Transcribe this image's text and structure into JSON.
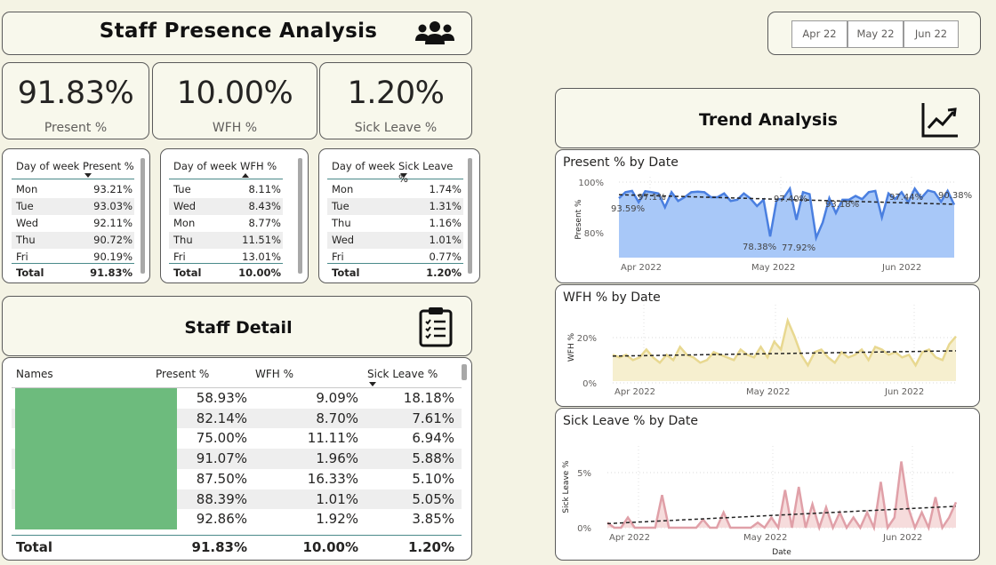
{
  "header": {
    "title": "Staff Presence Analysis",
    "icon": "people-group-icon"
  },
  "slicer": {
    "months": [
      "Apr 22",
      "May 22",
      "Jun 22"
    ]
  },
  "kpis": [
    {
      "value": "91.83%",
      "label": "Present %"
    },
    {
      "value": "10.00%",
      "label": "WFH %"
    },
    {
      "value": "1.20%",
      "label": "Sick Leave %"
    }
  ],
  "present_table": {
    "headers": [
      "Day of week",
      "Present %"
    ],
    "rows": [
      [
        "Mon",
        "93.21%"
      ],
      [
        "Tue",
        "93.03%"
      ],
      [
        "Wed",
        "92.11%"
      ],
      [
        "Thu",
        "90.72%"
      ],
      [
        "Fri",
        "90.19%"
      ]
    ],
    "total": [
      "Total",
      "91.83%"
    ]
  },
  "wfh_table": {
    "headers": [
      "Day of week",
      "WFH %"
    ],
    "rows": [
      [
        "Tue",
        "8.11%"
      ],
      [
        "Wed",
        "8.43%"
      ],
      [
        "Mon",
        "8.77%"
      ],
      [
        "Thu",
        "11.51%"
      ],
      [
        "Fri",
        "13.01%"
      ]
    ],
    "total": [
      "Total",
      "10.00%"
    ]
  },
  "sick_table": {
    "headers": [
      "Day of week",
      "Sick Leave %"
    ],
    "rows": [
      [
        "Mon",
        "1.74%"
      ],
      [
        "Tue",
        "1.31%"
      ],
      [
        "Thu",
        "1.16%"
      ],
      [
        "Wed",
        "1.01%"
      ],
      [
        "Fri",
        "0.77%"
      ]
    ],
    "total": [
      "Total",
      "1.20%"
    ]
  },
  "trend": {
    "title": "Trend Analysis",
    "icon": "line-chart-icon"
  },
  "staff_detail": {
    "title": "Staff Detail",
    "icon": "clipboard-checklist-icon",
    "headers": [
      "Names",
      "Present %",
      "WFH %",
      "Sick Leave %"
    ],
    "rows": [
      [
        "58.93%",
        "9.09%",
        "18.18%"
      ],
      [
        "82.14%",
        "8.70%",
        "7.61%"
      ],
      [
        "75.00%",
        "11.11%",
        "6.94%"
      ],
      [
        "91.07%",
        "1.96%",
        "5.88%"
      ],
      [
        "87.50%",
        "16.33%",
        "5.10%"
      ],
      [
        "88.39%",
        "1.01%",
        "5.05%"
      ],
      [
        "92.86%",
        "1.92%",
        "3.85%"
      ]
    ],
    "total": [
      "Total",
      "91.83%",
      "10.00%",
      "1.20%"
    ],
    "redaction_color": "#6dbb7d"
  },
  "chart_data": [
    {
      "type": "area",
      "title": "Present % by Date",
      "ylabel": "Present %",
      "xticks": [
        "Apr 2022",
        "May 2022",
        "Jun 2022"
      ],
      "yticks": [
        "100%",
        "80%"
      ],
      "ylim": [
        70,
        100
      ],
      "color": "#4a7fe0",
      "fill": "#a8c8f8",
      "values": [
        93.6,
        96,
        96.5,
        92,
        96.4,
        96,
        95.5,
        90,
        96,
        92.5,
        94,
        96,
        96.2,
        96,
        94,
        94,
        95.5,
        92.5,
        93,
        95.5,
        93.5,
        90.5,
        93,
        78.4,
        93,
        93.5,
        97.4,
        85,
        96,
        95.2,
        77.9,
        84,
        93.6,
        87.7,
        93,
        93,
        94.5,
        93.2,
        96,
        96.5,
        86,
        95.5,
        93.3,
        96,
        92,
        97.4,
        93.7,
        96.7,
        96,
        92.2,
        96.5,
        91
      ],
      "annotations": [
        "93.59%",
        "97.1%",
        "78.38%",
        "97.40%",
        "77.92%",
        "93.18%",
        "97.44%",
        "90.38%"
      ],
      "trend": [
        95,
        91.2
      ]
    },
    {
      "type": "area",
      "title": "WFH % by Date",
      "ylabel": "WFH %",
      "xticks": [
        "Apr 2022",
        "May 2022",
        "Jun 2022"
      ],
      "yticks": [
        "20%",
        "0%"
      ],
      "ylim": [
        0,
        27
      ],
      "color": "#e8d890",
      "fill": "#f6efcf",
      "values": [
        10,
        9,
        10,
        8,
        9,
        12,
        9,
        7,
        10,
        8,
        13,
        10,
        9,
        7,
        8,
        11,
        10,
        9,
        8,
        12,
        10,
        9,
        13,
        9,
        15,
        12,
        23,
        17,
        10,
        6,
        11,
        12,
        9,
        7,
        11,
        9,
        10,
        12,
        8,
        13,
        12,
        10,
        11,
        9,
        10,
        6,
        11,
        12,
        9,
        8,
        14,
        17
      ],
      "trend": [
        9.5,
        11.5
      ]
    },
    {
      "type": "area",
      "title": "Sick Leave % by Date",
      "ylabel": "Sick Leave %",
      "xlabel": "Date",
      "xticks": [
        "Apr 2022",
        "May 2022",
        "Jun 2022"
      ],
      "yticks": [
        "5%",
        "0%"
      ],
      "ylim": [
        0,
        7.5
      ],
      "color": "#e0a0a8",
      "fill": "#f6dcdc",
      "values": [
        0.5,
        0,
        0,
        1,
        0,
        0,
        0,
        0,
        3.2,
        0,
        0,
        0,
        0,
        0,
        0.8,
        0,
        0,
        1.5,
        0,
        0,
        0,
        0,
        0.5,
        0,
        1,
        0,
        3.7,
        0,
        4,
        0,
        2.3,
        0,
        2,
        0,
        1.5,
        0,
        1,
        0,
        1.5,
        0,
        4.5,
        0,
        1,
        6.5,
        2,
        0,
        1.5,
        0,
        3,
        0,
        1,
        2.5
      ],
      "trend": [
        0.4,
        2.1
      ]
    }
  ]
}
